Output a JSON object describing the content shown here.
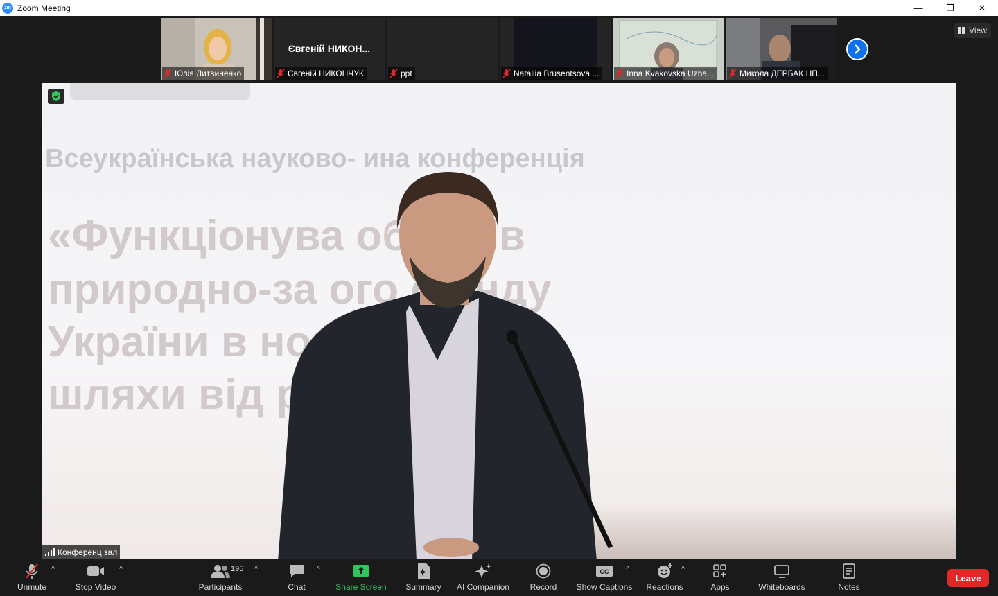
{
  "window": {
    "title": "Zoom Meeting",
    "logo_text": "zm",
    "controls": {
      "minimize": "—",
      "restore": "❐",
      "close": "✕"
    }
  },
  "gallery": {
    "view_label": "View",
    "tiles": [
      {
        "name": "Юлія Литвиненко",
        "muted": true
      },
      {
        "name": "Євгеній НИКОНЧУК",
        "big_name": "Євгеній  НИКОН...",
        "muted": true
      },
      {
        "name": "ppt",
        "muted": true
      },
      {
        "name": "Nataliia Brusentsova ...",
        "muted": true
      },
      {
        "name": "Inna Kvakovska Uzha...",
        "muted": true
      },
      {
        "name": "Микола ДЕРБАК НП...",
        "muted": true
      }
    ]
  },
  "main_video": {
    "slide_subtitle": "Всеукраїнська науково-               ина конференція",
    "slide_line1": "«Функціонува        об’єктів",
    "slide_line2": "природно-за               ого фонду",
    "slide_line3": "України в                 ного стану:",
    "slide_line4": "шляхи від                  розвитку»",
    "room_label": "Конференц зал"
  },
  "toolbar": {
    "unmute": "Unmute",
    "stop_video": "Stop Video",
    "participants": "Participants",
    "participants_count": "195",
    "chat": "Chat",
    "share_screen": "Share Screen",
    "summary": "Summary",
    "ai_companion": "AI Companion",
    "record": "Record",
    "show_captions": "Show Captions",
    "cc_badge": "CC",
    "reactions": "Reactions",
    "apps": "Apps",
    "whiteboards": "Whiteboards",
    "notes": "Notes",
    "leave": "Leave",
    "caret": "^"
  },
  "colors": {
    "share_green": "#35c35c",
    "leave_red": "#e02828",
    "accent_blue": "#0e72ed",
    "muted_red": "#e02828"
  }
}
